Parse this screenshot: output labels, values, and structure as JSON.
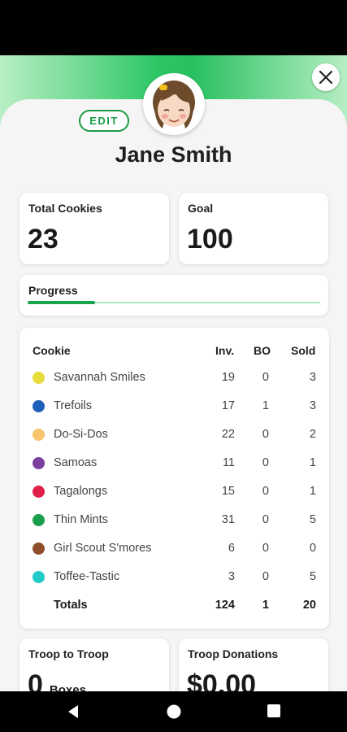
{
  "profile": {
    "name": "Jane Smith",
    "edit_label": "EDIT"
  },
  "stats": {
    "total_cookies_label": "Total Cookies",
    "total_cookies_value": "23",
    "goal_label": "Goal",
    "goal_value": "100"
  },
  "progress": {
    "label": "Progress",
    "fraction": 0.23
  },
  "table": {
    "headers": {
      "cookie": "Cookie",
      "inv": "Inv.",
      "bo": "BO",
      "sold": "Sold"
    },
    "rows": [
      {
        "name": "Savannah Smiles",
        "color": "#e6dc3b",
        "inv": "19",
        "bo": "0",
        "sold": "3"
      },
      {
        "name": "Trefoils",
        "color": "#1f5fb8",
        "inv": "17",
        "bo": "1",
        "sold": "3"
      },
      {
        "name": "Do-Si-Dos",
        "color": "#f6c56d",
        "inv": "22",
        "bo": "0",
        "sold": "2"
      },
      {
        "name": "Samoas",
        "color": "#7b3fa0",
        "inv": "11",
        "bo": "0",
        "sold": "1"
      },
      {
        "name": "Tagalongs",
        "color": "#e0204a",
        "inv": "15",
        "bo": "0",
        "sold": "1"
      },
      {
        "name": "Thin Mints",
        "color": "#1c9e4e",
        "inv": "31",
        "bo": "0",
        "sold": "5"
      },
      {
        "name": "Girl Scout S'mores",
        "color": "#8f4f2b",
        "inv": "6",
        "bo": "0",
        "sold": "0"
      },
      {
        "name": "Toffee-Tastic",
        "color": "#22c9c9",
        "inv": "3",
        "bo": "0",
        "sold": "5"
      }
    ],
    "totals": {
      "label": "Totals",
      "inv": "124",
      "bo": "1",
      "sold": "20"
    }
  },
  "troop": {
    "t2t_label": "Troop to Troop",
    "t2t_value": "0",
    "t2t_unit": "Boxes",
    "donations_label": "Troop Donations",
    "donations_value": "$0.00"
  },
  "icons": {
    "close": "close-icon",
    "back": "nav-back-icon",
    "home": "nav-home-icon",
    "recents": "nav-recents-icon"
  }
}
